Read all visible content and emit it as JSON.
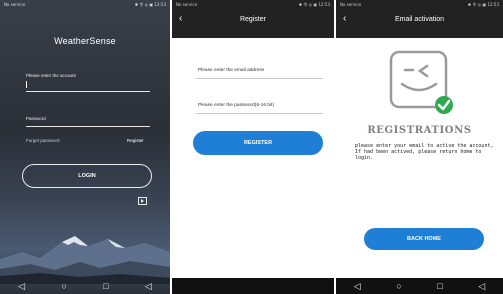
{
  "login_screen": {
    "status_left": "No service",
    "status_right": "✱ 令 ◎ ▣ 12:53",
    "brand": "WeatherSense",
    "account_placeholder": "Please enter the account",
    "password_placeholder": "Password",
    "forgot_password": "Forget password",
    "register_link": "Register",
    "login_button": "LOGIN",
    "nav": [
      "◁",
      "○",
      "□",
      "◁"
    ]
  },
  "register_screen": {
    "status_left": "No service",
    "status_right": "✱ 令 ◎ ▣ 12:53",
    "title": "Register",
    "back_icon": "back-arrow-icon",
    "email_placeholder": "Please enter the email address",
    "password_placeholder": "Please enter the password(6-16 bit)",
    "register_button": "REGISTER"
  },
  "activation_screen": {
    "status_left": "No service",
    "status_right": "✱ 令 ◎ ▣ 12:53",
    "title": "Email activation",
    "back_icon": "back-arrow-icon",
    "heading": "REGISTRATIONS",
    "message": "please enter your email to active the account, If had been actived, please return home to login.",
    "back_home_button": "BACK HOME",
    "nav": [
      "◁",
      "○",
      "□",
      "◁"
    ]
  },
  "colors": {
    "accent_blue": "#1f7fd6",
    "success_green": "#2fa84f",
    "dark_header": "#222222"
  }
}
